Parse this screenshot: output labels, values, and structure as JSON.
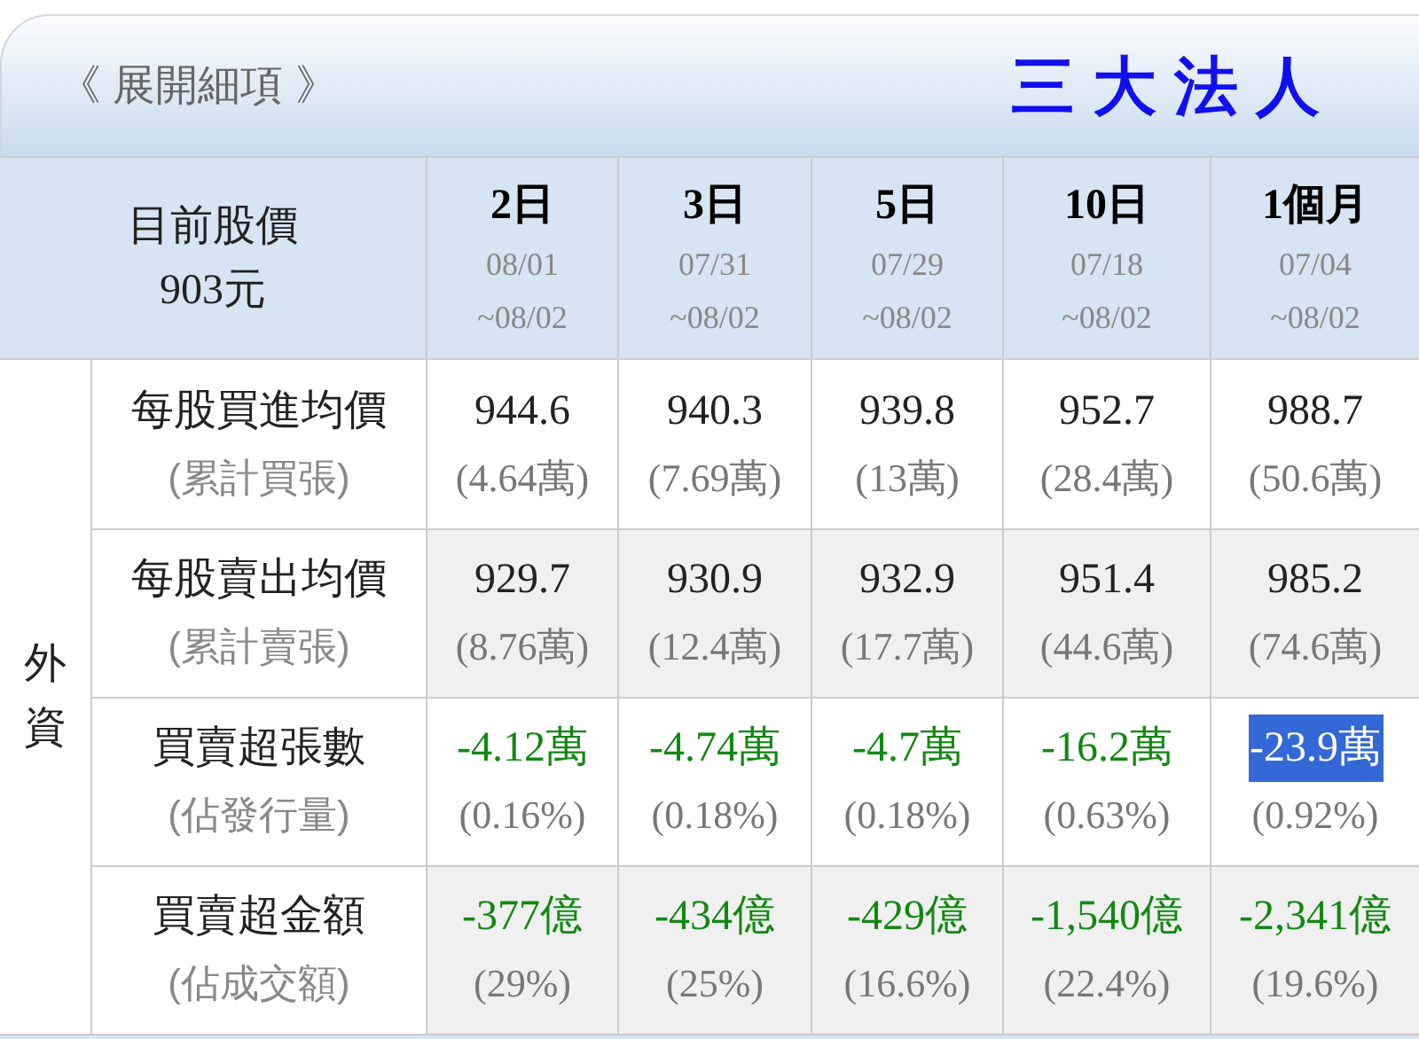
{
  "header": {
    "expand_link": "《 展開細項 》",
    "title": "三 大 法 人"
  },
  "price": {
    "label": "目前股價",
    "value": "903元"
  },
  "periods": [
    {
      "label": "2日",
      "from": "08/01",
      "to": "~08/02"
    },
    {
      "label": "3日",
      "from": "07/31",
      "to": "~08/02"
    },
    {
      "label": "5日",
      "from": "07/29",
      "to": "~08/02"
    },
    {
      "label": "10日",
      "from": "07/18",
      "to": "~08/02"
    },
    {
      "label": "1個月",
      "from": "07/04",
      "to": "~08/02"
    }
  ],
  "group": {
    "label": "外資",
    "rows": [
      {
        "label": "每股買進均價",
        "sublabel": "(累計買張)",
        "shaded": false,
        "cells": [
          {
            "value": "944.6",
            "sub": "(4.64萬)",
            "negative": false,
            "selected": false
          },
          {
            "value": "940.3",
            "sub": "(7.69萬)",
            "negative": false,
            "selected": false
          },
          {
            "value": "939.8",
            "sub": "(13萬)",
            "negative": false,
            "selected": false
          },
          {
            "value": "952.7",
            "sub": "(28.4萬)",
            "negative": false,
            "selected": false
          },
          {
            "value": "988.7",
            "sub": "(50.6萬)",
            "negative": false,
            "selected": false
          }
        ]
      },
      {
        "label": "每股賣出均價",
        "sublabel": "(累計賣張)",
        "shaded": true,
        "cells": [
          {
            "value": "929.7",
            "sub": "(8.76萬)",
            "negative": false,
            "selected": false
          },
          {
            "value": "930.9",
            "sub": "(12.4萬)",
            "negative": false,
            "selected": false
          },
          {
            "value": "932.9",
            "sub": "(17.7萬)",
            "negative": false,
            "selected": false
          },
          {
            "value": "951.4",
            "sub": "(44.6萬)",
            "negative": false,
            "selected": false
          },
          {
            "value": "985.2",
            "sub": "(74.6萬)",
            "negative": false,
            "selected": false
          }
        ]
      },
      {
        "label": "買賣超張數",
        "sublabel": "(佔發行量)",
        "shaded": false,
        "cells": [
          {
            "value": "-4.12萬",
            "sub": "(0.16%)",
            "negative": true,
            "selected": false
          },
          {
            "value": "-4.74萬",
            "sub": "(0.18%)",
            "negative": true,
            "selected": false
          },
          {
            "value": "-4.7萬",
            "sub": "(0.18%)",
            "negative": true,
            "selected": false
          },
          {
            "value": "-16.2萬",
            "sub": "(0.63%)",
            "negative": true,
            "selected": false
          },
          {
            "value": "-23.9萬",
            "sub": "(0.92%)",
            "negative": true,
            "selected": true
          }
        ]
      },
      {
        "label": "買賣超金額",
        "sublabel": "(佔成交額)",
        "shaded": true,
        "cells": [
          {
            "value": "-377億",
            "sub": "(29%)",
            "negative": true,
            "selected": false
          },
          {
            "value": "-434億",
            "sub": "(25%)",
            "negative": true,
            "selected": false
          },
          {
            "value": "-429億",
            "sub": "(16.6%)",
            "negative": true,
            "selected": false
          },
          {
            "value": "-1,540億",
            "sub": "(22.4%)",
            "negative": true,
            "selected": false
          },
          {
            "value": "-2,341億",
            "sub": "(19.6%)",
            "negative": true,
            "selected": false
          }
        ]
      }
    ]
  }
}
